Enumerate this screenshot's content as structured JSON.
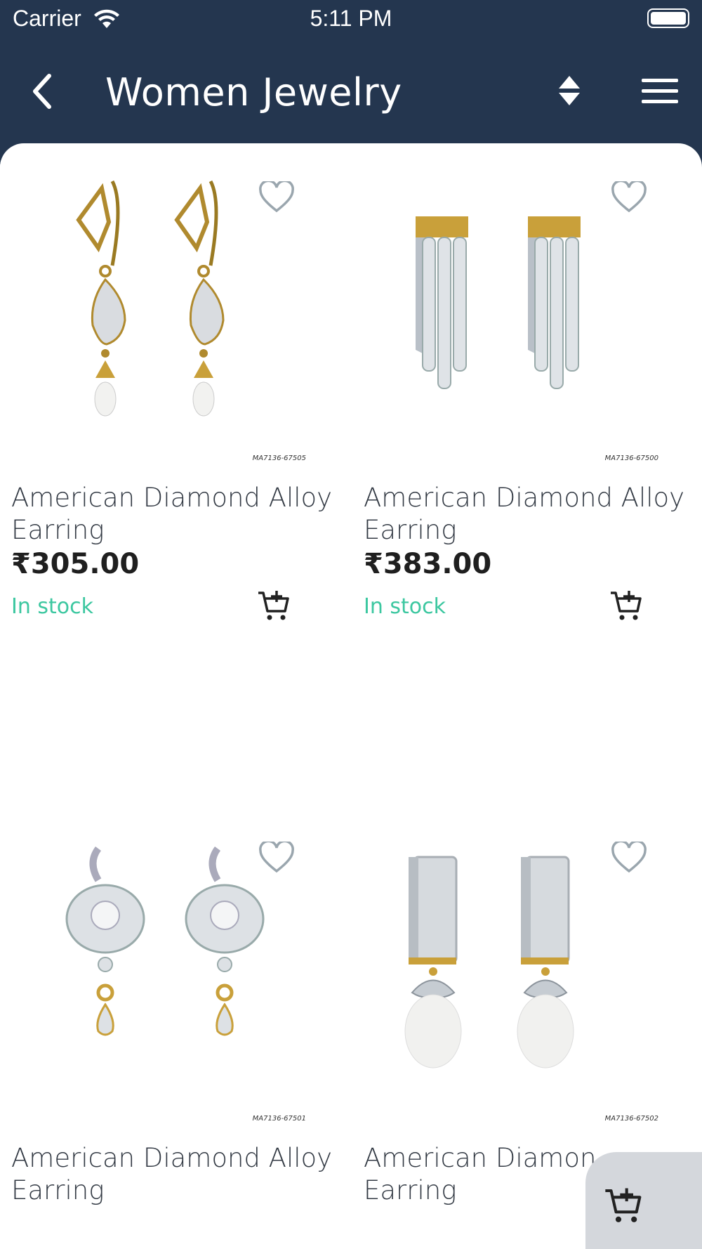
{
  "status_bar": {
    "carrier": "Carrier",
    "time": "5:11 PM"
  },
  "header": {
    "title": "Women Jewelry",
    "back_icon": "chevron-left-icon",
    "sort_icon": "sort-icon",
    "menu_icon": "hamburger-menu-icon",
    "background_color": "#24364f"
  },
  "products": [
    {
      "name": "American Diamond Alloy Earring",
      "price": "₹305.00",
      "stock": "In stock",
      "sku": "MA7136-67505"
    },
    {
      "name": "American Diamond Alloy Earring",
      "price": "₹383.00",
      "stock": "In stock",
      "sku": "MA7136-67500"
    },
    {
      "name": "American Diamond Alloy Earring",
      "sku": "MA7136-67501"
    },
    {
      "name": "American Diamon Earring",
      "sku": "MA7136-67502"
    }
  ],
  "colors": {
    "in_stock": "#3cc7a0",
    "header": "#24364f",
    "floating_button": "#d4d7dc"
  },
  "icons": {
    "favorite": "heart-outline-icon",
    "add_to_cart": "cart-plus-icon"
  }
}
